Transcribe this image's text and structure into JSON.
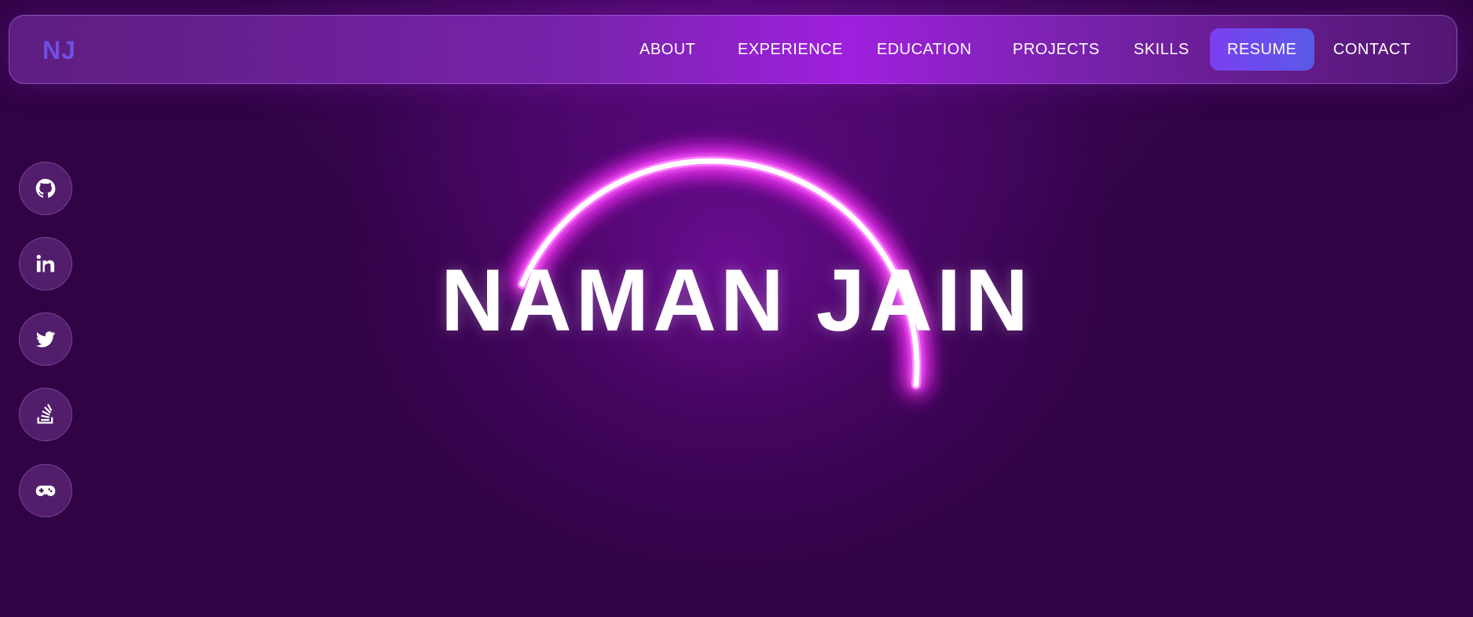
{
  "navbar": {
    "logo": "NJ",
    "items": [
      {
        "label": "ABOUT"
      },
      {
        "label": "EXPERIENCE"
      },
      {
        "label": "EDUCATION"
      },
      {
        "label": "PROJECTS"
      },
      {
        "label": "SKILLS"
      },
      {
        "label": "RESUME"
      },
      {
        "label": "CONTACT"
      }
    ]
  },
  "social": [
    {
      "icon": "github-icon"
    },
    {
      "icon": "linkedin-icon"
    },
    {
      "icon": "twitter-icon"
    },
    {
      "icon": "stackoverflow-icon"
    },
    {
      "icon": "gamepad-icon"
    }
  ],
  "hero": {
    "name": "NAMAN JAIN"
  },
  "colors": {
    "background": "#2f0344",
    "accent": "#ff40ff",
    "logo": "#6f4fe6",
    "resume_button": "#7a3ff0"
  }
}
